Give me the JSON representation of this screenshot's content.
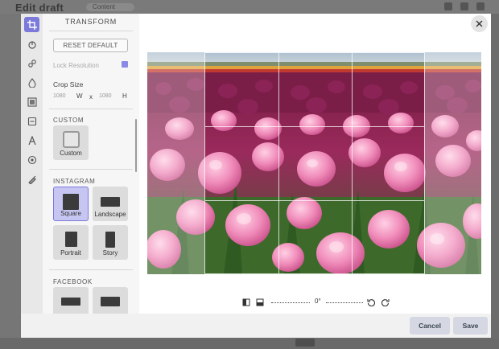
{
  "backdrop": {
    "title": "Edit draft",
    "pill": "Content"
  },
  "panel": {
    "title": "TRANSFORM",
    "reset_label": "RESET DEFAULT",
    "lock_label": "Lock Resolution",
    "crop_label": "Crop Size",
    "width_value": "1080",
    "width_unit": "W",
    "x_sep": "x",
    "height_value": "1080",
    "height_unit": "H",
    "sections": {
      "custom": "CUSTOM",
      "instagram": "INSTAGRAM",
      "facebook": "FACEBOOK"
    },
    "presets": {
      "custom": "Custom",
      "square": "Square",
      "landscape": "Landscape",
      "portrait": "Portrait",
      "story": "Story"
    }
  },
  "tools": [
    "crop-icon",
    "fill-icon",
    "adjust-icon",
    "drop-icon",
    "frame-icon",
    "sticker-icon",
    "text-icon",
    "palette-icon",
    "brush-icon"
  ],
  "rotate": {
    "value": "0°"
  },
  "footer": {
    "cancel": "Cancel",
    "save": "Save"
  },
  "colors": {
    "accent": "#7b79d9",
    "selected_preset_bg": "#c7c6f3"
  }
}
